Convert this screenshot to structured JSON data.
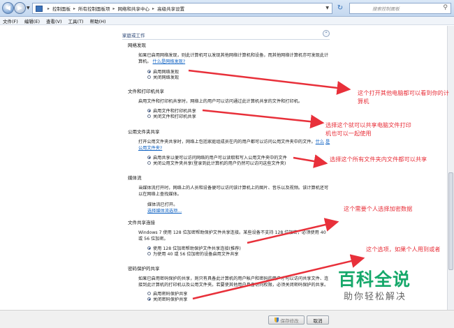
{
  "address_bar": {
    "breadcrumbs": [
      "控制面板",
      "所有控制面板项",
      "网络和共享中心",
      "高级共享设置"
    ],
    "search_placeholder": "搜索控制面板"
  },
  "menu": [
    "文件(F)",
    "编辑(E)",
    "查看(V)",
    "工具(T)",
    "帮助(H)"
  ],
  "group_title": "家庭或工作",
  "sections": {
    "discovery": {
      "title": "网络发现",
      "desc": "如果已启用网络发现，则此计算机可以发现其他网络计算机和设备，而其他网络计算机亦可发现此计算机。",
      "link": "什么是网络发现?",
      "options": [
        "启用网络发现",
        "关闭网络发现"
      ]
    },
    "file_printer": {
      "title": "文件和打印机共享",
      "desc": "启用文件和打印机共享时，网络上的用户可以访问通过此计算机共享的文件和打印机。",
      "options": [
        "启用文件和打印机共享",
        "关闭文件和打印机共享"
      ]
    },
    "public_folder": {
      "title": "公用文件夹共享",
      "desc": "打开公用文件夹共享时，网络上包括家庭组成员在内的用户都可以访问公用文件夹中的文件。",
      "link_inline": "什么",
      "link": "是公用文件夹?",
      "options": [
        "启用共享以便可以访问网络的用户可以读取和写入公用文件夹中的文件",
        "关闭公用文件夹共享(登录到此计算机的用户仍然可以访问这些文件夹)"
      ]
    },
    "media": {
      "title": "媒体流",
      "desc": "当媒体流打开时，网络上的人员和设备便可以访问该计算机上的图片、音乐以及视频。该计算机还可以在网络上查找媒体。",
      "status": "媒体流已打开。",
      "link": "选择媒体流选项..."
    },
    "connection": {
      "title": "文件共享连接",
      "desc": "Windows 7 使用 128 位加密帮助保护文件共享连接。某些设备不支持 128 位加密，必须使用 40 或 56 位加密。",
      "options": [
        "使用 128 位加密帮助保护文件共享连接(推荐)",
        "为使用 40 或 56 位加密的设备启用文件共享"
      ]
    },
    "password": {
      "title": "密码保护的共享",
      "desc": "如果已启用密码保护的共享，则只有具备此计算机的用户帐户和密码的用户才可以访问共享文件、连接到此计算机的打印机以及公用文件夹。若要使其他用户具备访问权限，必须关闭密码保护的共享。",
      "options": [
        "启用密码保护共享",
        "关闭密码保护共享"
      ]
    }
  },
  "buttons": {
    "save": "保存修改",
    "cancel": "取消"
  },
  "annotations": {
    "a1": "这个打开其他电脑都可以看到你的计算机",
    "a2": "选择这个就可以共享电脑文件打印机也可以一起使用",
    "a3": "选择这个所有文件夹内文件都可以共享",
    "a4": "这个需要个人选择加密数据",
    "a5": "这个选项，如果个人用到或者"
  },
  "watermark": {
    "title": "百科全说",
    "subtitle": "助你轻松解决"
  },
  "colors": {
    "annotation": "#e8303a",
    "watermark": "#16a86a",
    "link": "#0a5fc2"
  }
}
